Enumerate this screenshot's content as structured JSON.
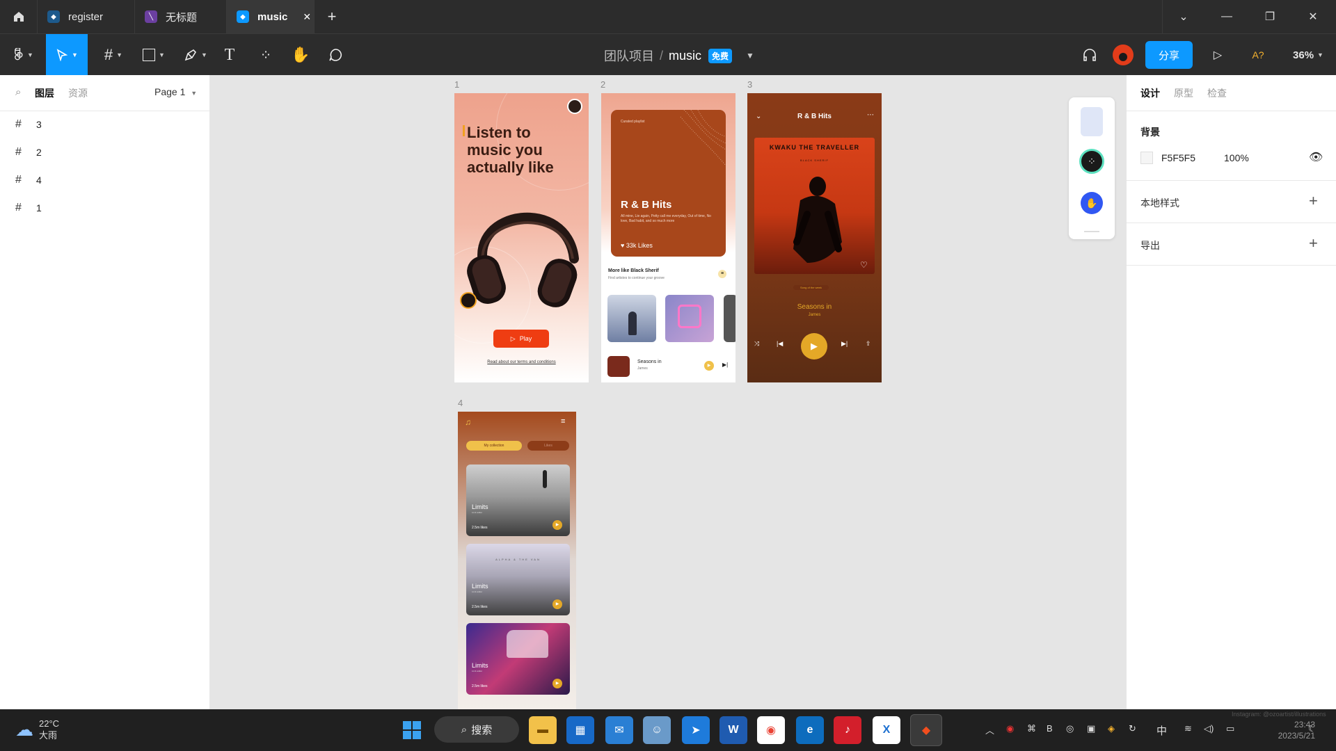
{
  "tabs": [
    {
      "label": "register"
    },
    {
      "label": "无标题"
    },
    {
      "label": "music"
    }
  ],
  "toolbar": {
    "breadcrumb_team": "团队项目",
    "breadcrumb_sep": "/",
    "file_name": "music",
    "plan_badge": "免费",
    "share_label": "分享",
    "a_label": "A?",
    "zoom": "36%"
  },
  "left_panel": {
    "tab_layers": "图层",
    "tab_assets": "资源",
    "page_select": "Page 1",
    "layers": [
      "3",
      "2",
      "4",
      "1"
    ]
  },
  "canvas": {
    "frame_labels": [
      "1",
      "2",
      "3",
      "4"
    ],
    "frame1": {
      "headline": "Listen to music you actually like",
      "play_label": "Play",
      "terms": "Read about our terms and conditions"
    },
    "frame2": {
      "curated": "Curated playlist",
      "title": "R & B Hits",
      "desc": "All mine, Lie again, Petty call me everyday, Out of time, No love, Bad habit, and so much more",
      "likes": "33k Likes",
      "more_title": "More like Black Sherif",
      "more_sub": "Find artistes to continue your groove",
      "now_title": "Seasons in",
      "now_artist": "James"
    },
    "frame3": {
      "header": "R & B Hits",
      "cover_title": "KWAKU THE TRAVELLER",
      "cover_sub": "BLACK SHERIF",
      "badge": "Song of the week",
      "song": "Seasons in",
      "artist": "James"
    },
    "frame4": {
      "tab_active": "My collection",
      "tab_inactive": "Likes",
      "cards": [
        {
          "title": "Limits",
          "sub": "Limit wallet",
          "likes": "2.5m likes"
        },
        {
          "title": "Limits",
          "sub": "Limit wallet",
          "likes": "2.5m likes",
          "overlay": "ALPHA & THE VAN"
        },
        {
          "title": "Limits",
          "sub": "Limit wallet",
          "likes": "2.5m likes"
        }
      ]
    }
  },
  "right_panel": {
    "tab_design": "设计",
    "tab_prototype": "原型",
    "tab_inspect": "检查",
    "background_label": "背景",
    "bg_hex": "F5F5F5",
    "bg_opacity": "100%",
    "local_styles": "本地样式",
    "export": "导出"
  },
  "help_label": "?",
  "taskbar": {
    "weather_temp": "22°C",
    "weather_desc": "大雨",
    "search_label": "搜索",
    "ime": "中",
    "time": "23:43",
    "date": "2023/5/21",
    "watermark": "Instagram: @ozoartist/illustrations"
  },
  "colors": {
    "accent": "#0d99ff",
    "frame_peach": "#f0a892",
    "frame_brown": "#8b3a17",
    "orange": "#f04b13",
    "gold": "#e4a827"
  }
}
